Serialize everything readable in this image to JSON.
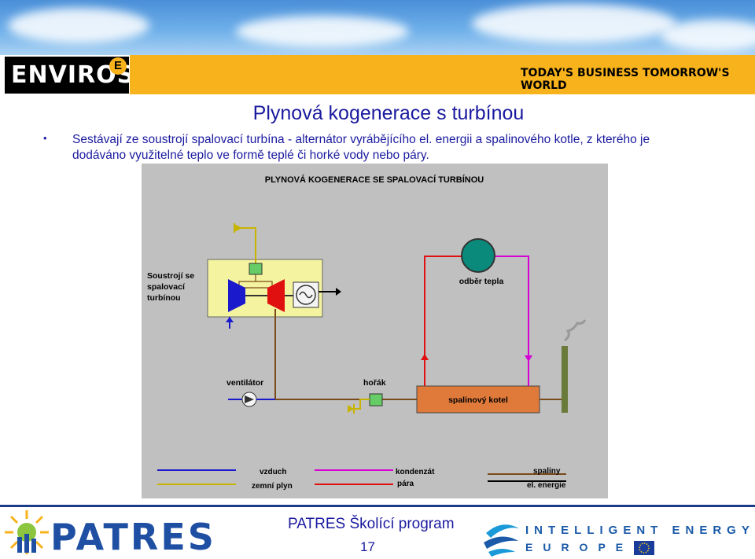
{
  "header": {
    "brand": "ENVIROS",
    "brand_mark": "E",
    "tagline": "TODAY'S BUSINESS TOMORROW'S WORLD"
  },
  "slide": {
    "title": "Plynová kogenerace s turbínou",
    "bullet_symbol": "•",
    "bullet_line1": "Sestávají ze soustrojí spalovací turbína - alternátor vyrábějícího el. energii a spalinového kotle, z kterého je",
    "bullet_line2": "dodáváno využitelné teplo ve formě teplé či horké vody nebo páry."
  },
  "diagram": {
    "title": "PLYNOVÁ KOGENERACE SE SPALOVACÍ TURBÍNOU",
    "label_turbine_line1": "Soustrojí se",
    "label_turbine_line2": "spalovací",
    "label_turbine_line3": "turbínou",
    "label_heat": "odběr tepla",
    "label_fan": "ventilátor",
    "label_burner": "hořák",
    "label_boiler": "spalinový kotel",
    "legend": [
      {
        "label": "vzduch",
        "color": "#1a1acc"
      },
      {
        "label": "zemní plyn",
        "color": "#c8b400"
      },
      {
        "label": "kondenzát",
        "color": "#d400d4"
      },
      {
        "label": "pára",
        "color": "#e01010"
      },
      {
        "label": "spaliny",
        "color": "#7a4a1a"
      },
      {
        "label": "el. energie",
        "color": "#000000"
      }
    ],
    "colors": {
      "background": "#c0c0c0",
      "turbine_box": "#f4f4a0",
      "boiler": "#e07a3a",
      "heat_consumer": "#0a8a7a",
      "chimney": "#6a7a3a",
      "valve": "#66cc66"
    }
  },
  "footer": {
    "patres": "PATRES",
    "program": "PATRES Školící program",
    "page": "17",
    "ie_line1": "INTELLIGENT ENERGY",
    "ie_line2": "EUROPE"
  }
}
